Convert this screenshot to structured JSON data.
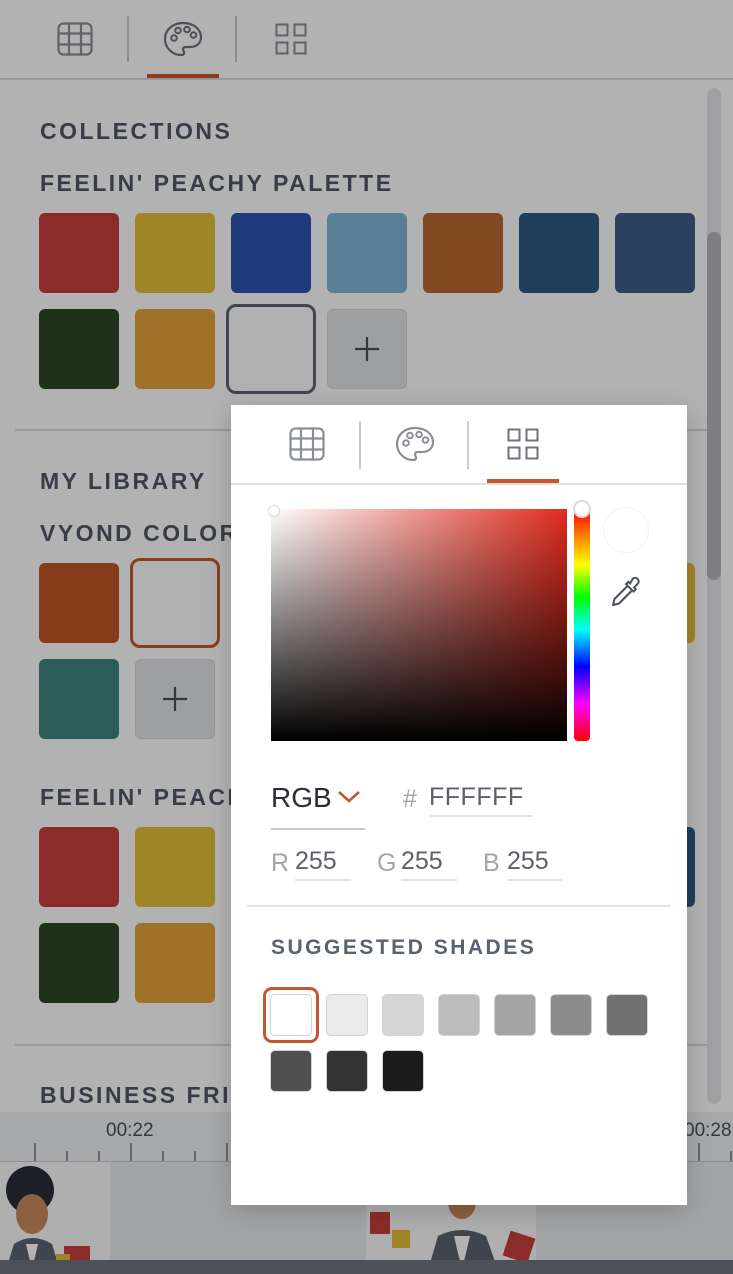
{
  "icons": {
    "tab_grid": "grid-icon",
    "tab_palette": "palette-icon",
    "tab_swatches": "swatches-icon",
    "add": "plus-icon",
    "eyedropper": "eyedropper-icon",
    "dropdown": "chevron-down-icon"
  },
  "panel": {
    "collections": {
      "title": "COLLECTIONS",
      "palette_name": "FEELIN' PEACHY PALETTE",
      "swatches": [
        "#c8403d",
        "#e6bf38",
        "#2e55b3",
        "#7eb7d6",
        "#ba6a31",
        "#2e5b84",
        "#3e5e8a",
        "#2d4824",
        "#e6a33c",
        "#fdfdfd"
      ]
    },
    "my_library": {
      "title": "MY LIBRARY",
      "palette_1": {
        "name": "VYOND COLOR",
        "swatches": [
          "#c05528",
          "#fdfdfd",
          "#e6bf38",
          "#3d8580"
        ]
      },
      "palette_2": {
        "name": "FEELIN' PEACHY",
        "swatches": [
          "#c8403d",
          "#e6bf38",
          "#2e5b84",
          "#2d4824",
          "#e6a33c"
        ]
      },
      "palette_3_name": "BUSINESS FRIE"
    },
    "timeline": {
      "label_1": "00:22",
      "label_2": "00:28"
    }
  },
  "picker": {
    "hue_color": "#e02b1f",
    "mode": "RGB",
    "hash_label": "#",
    "hex": "FFFFFF",
    "r_label": "R",
    "r": "255",
    "g_label": "G",
    "g": "255",
    "b_label": "B",
    "b": "255",
    "shades_title": "SUGGESTED SHADES",
    "shades": [
      "#ffffff",
      "#ebebeb",
      "#d4d4d4",
      "#bcbcbc",
      "#a4a4a4",
      "#8c8c8c",
      "#727272",
      "#4f4f4f",
      "#333333",
      "#1c1c1c"
    ],
    "accent": "#c4572d"
  }
}
